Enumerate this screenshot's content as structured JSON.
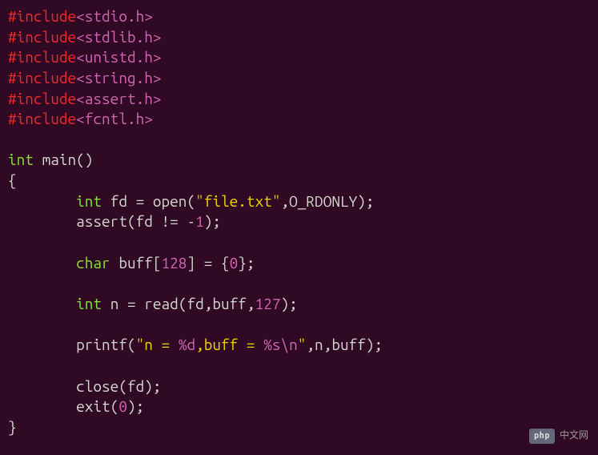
{
  "code": {
    "includes": [
      {
        "directive": "#include",
        "path": "<stdio.h>"
      },
      {
        "directive": "#include",
        "path": "<stdlib.h>"
      },
      {
        "directive": "#include",
        "path": "<unistd.h>"
      },
      {
        "directive": "#include",
        "path": "<string.h>"
      },
      {
        "directive": "#include",
        "path": "<assert.h>"
      },
      {
        "directive": "#include",
        "path": "<fcntl.h>"
      }
    ],
    "main_signature": {
      "return_type": "int",
      "name": "main",
      "params": "()"
    },
    "body": {
      "line1": {
        "type": "int",
        "var": "fd",
        "eq": " = ",
        "fn": "open",
        "lp": "(",
        "str": "\"file.txt\"",
        "comma": ",",
        "flag": "O_RDONLY",
        "rp": ");"
      },
      "line2": {
        "fn": "assert",
        "lp": "(",
        "expr": "fd != -",
        "num": "1",
        "rp": ");"
      },
      "line3": {
        "type": "char",
        "var": "buff",
        "lbrk": "[",
        "size": "128",
        "rbrk": "]",
        "eq": " = {",
        "zero": "0",
        "end": "};"
      },
      "line4": {
        "type": "int",
        "var": "n",
        "eq": " = ",
        "fn": "read",
        "lp": "(",
        "args": "fd,buff,",
        "num": "127",
        "rp": ");"
      },
      "line5": {
        "fn": "printf",
        "lp": "(",
        "q1": "\"",
        "s1": "n = ",
        "fmt1": "%d",
        "s2": ",buff = ",
        "fmt2": "%s",
        "esc": "\\n",
        "q2": "\"",
        "args": ",n,buff",
        "rp": ");"
      },
      "line6": {
        "fn": "close",
        "lp": "(",
        "arg": "fd",
        "rp": ");"
      },
      "line7": {
        "fn": "exit",
        "lp": "(",
        "num": "0",
        "rp": ");"
      }
    },
    "braces": {
      "open": "{",
      "close": "}"
    }
  },
  "watermark": {
    "badge": "php",
    "text": "中文网"
  }
}
